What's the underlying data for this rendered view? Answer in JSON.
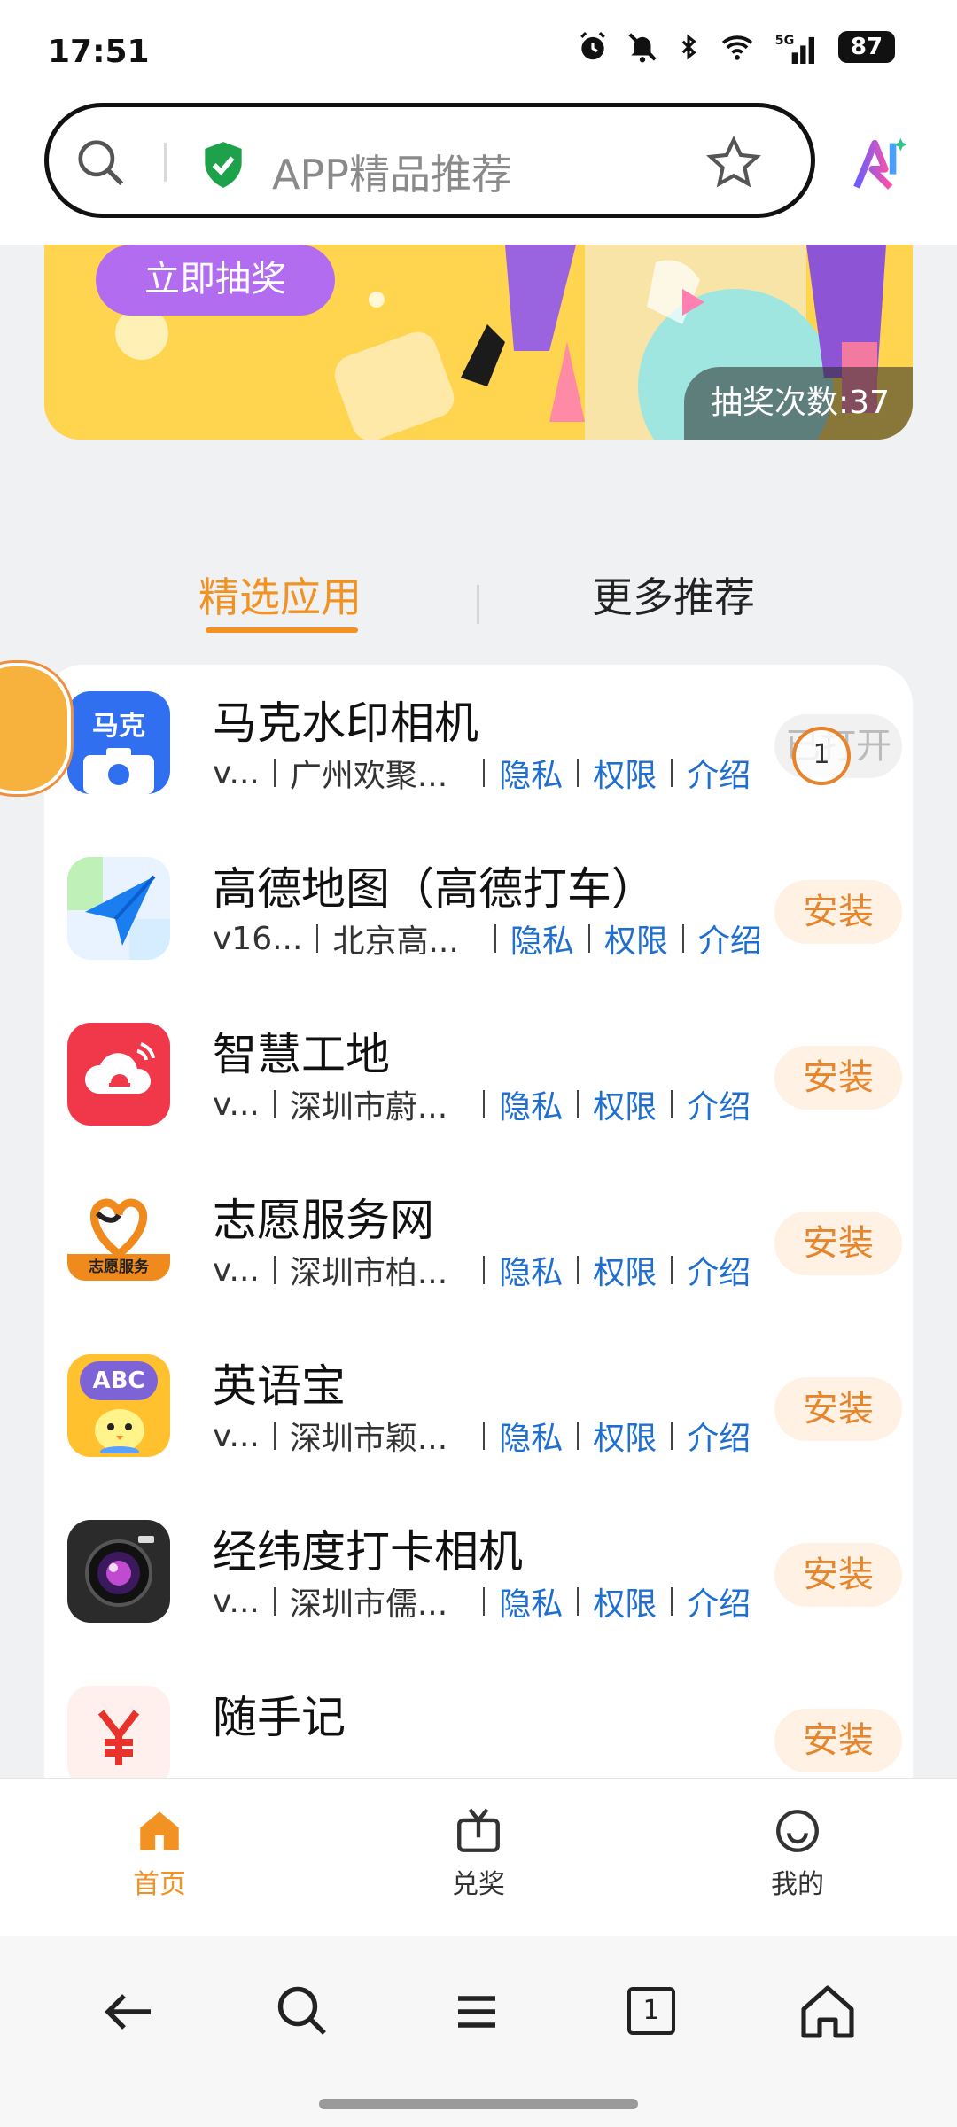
{
  "status": {
    "time": "17:51",
    "battery": "87"
  },
  "search": {
    "placeholder": "APP精品推荐"
  },
  "banner": {
    "button": "立即抽奖",
    "draw_count": "抽奖次数:37"
  },
  "tabs": {
    "selected": "精选应用",
    "other": "更多推荐"
  },
  "apps": [
    {
      "name": "马克水印相机",
      "version": "v...",
      "developer": "广州欢聚...",
      "privacy": "隐私",
      "permissions": "权限",
      "intro": "介绍",
      "action": "已打开",
      "badge": "1"
    },
    {
      "name": "高德地图（高德打车）",
      "version": "v16...",
      "developer": "北京高...",
      "privacy": "隐私",
      "permissions": "权限",
      "intro": "介绍",
      "action": "安装"
    },
    {
      "name": "智慧工地",
      "version": "v...",
      "developer": "深圳市蔚...",
      "privacy": "隐私",
      "permissions": "权限",
      "intro": "介绍",
      "action": "安装"
    },
    {
      "name": "志愿服务网",
      "version": "v...",
      "developer": "深圳市柏...",
      "privacy": "隐私",
      "permissions": "权限",
      "intro": "介绍",
      "action": "安装"
    },
    {
      "name": "英语宝",
      "version": "v...",
      "developer": "深圳市颖...",
      "privacy": "隐私",
      "permissions": "权限",
      "intro": "介绍",
      "action": "安装"
    },
    {
      "name": "经纬度打卡相机",
      "version": "v...",
      "developer": "深圳市儒...",
      "privacy": "隐私",
      "permissions": "权限",
      "intro": "介绍",
      "action": "安装"
    },
    {
      "name": "随手记",
      "action": "安装"
    }
  ],
  "icons": {
    "app1_text": "马克",
    "app4_text": "志愿服务",
    "app5_text": "ABC"
  },
  "bottom_nav": {
    "home": "首页",
    "rewards": "兑奖",
    "mine": "我的"
  },
  "tab_count": "1",
  "colors": {
    "accent": "#f29222",
    "link": "#1f6fd1",
    "banner": "#ffd44e"
  }
}
